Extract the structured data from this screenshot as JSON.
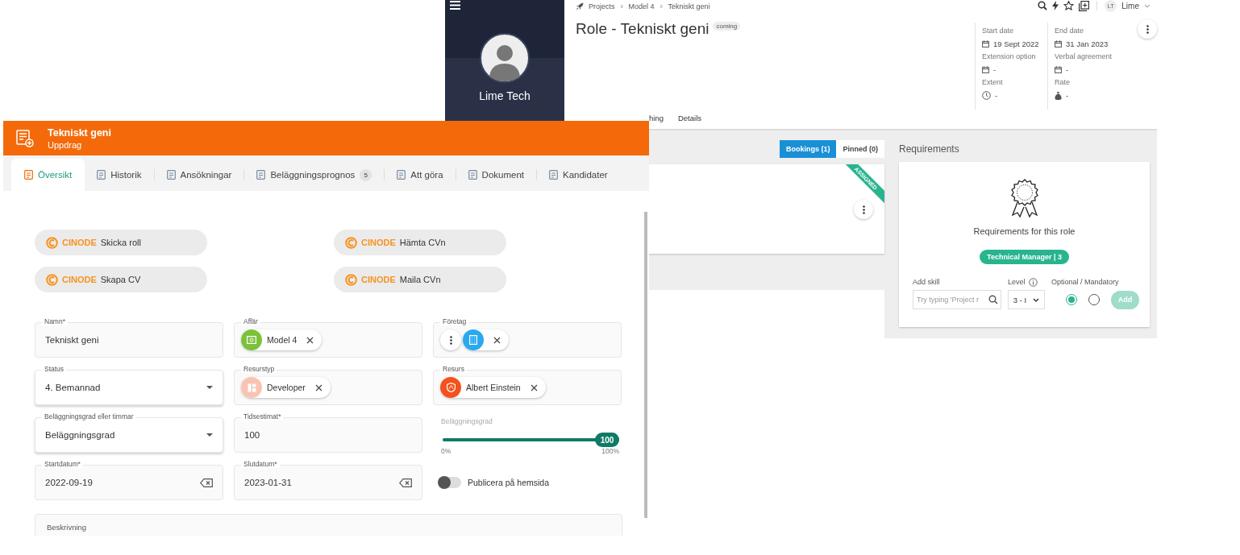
{
  "back_window": {
    "sidebar": {
      "user_name": "Lime Tech"
    },
    "breadcrumb": [
      "Projects",
      "Model 4",
      "Tekniskt geni"
    ],
    "title": "Role - Tekniskt geni",
    "status_badge": "coming",
    "user_menu": {
      "initials": "LT",
      "name": "Lime"
    },
    "info_columns": [
      [
        {
          "label": "Start date",
          "value": "19 Sept 2022",
          "kind": "date"
        },
        {
          "label": "Extension option",
          "value": "-",
          "kind": "date"
        },
        {
          "label": "Extent",
          "value": "-",
          "kind": "time"
        }
      ],
      [
        {
          "label": "End date",
          "value": "31 Jan 2023",
          "kind": "date"
        },
        {
          "label": "Verbal agreement",
          "value": "-",
          "kind": "date"
        },
        {
          "label": "Rate",
          "value": "-",
          "kind": "money"
        }
      ]
    ],
    "tabs": [
      {
        "label": "hing",
        "selected": false
      },
      {
        "label": "Details",
        "selected": false
      }
    ],
    "booking_filters": [
      {
        "label": "Bookings (1)",
        "selected": true
      },
      {
        "label": "Pinned (0)",
        "selected": false
      }
    ],
    "booking_card": {
      "ribbon": "ASSIGNED"
    },
    "requirements": {
      "title": "Requirements",
      "caption": "Requirements for this role",
      "skills": [
        "Technical Manager | 3"
      ],
      "add_skill_label": "Add skill",
      "placeholder": "Try typing 'Project r",
      "level_label": "Level",
      "level_value": "3 - I",
      "option_label": "Optional / Mandatory",
      "options": [
        {
          "selected": true
        },
        {
          "selected": false
        }
      ],
      "add_button": {
        "label": "Add",
        "disabled": true
      }
    }
  },
  "front_window": {
    "title": "Tekniskt geni",
    "subtitle": "Uppdrag",
    "tabs": [
      {
        "label": "Översikt",
        "selected": true
      },
      {
        "label": "Historik",
        "selected": false
      },
      {
        "label": "Ansökningar",
        "selected": false
      },
      {
        "label": "Beläggningsprognos",
        "selected": false,
        "badge": "5"
      },
      {
        "label": "Att göra",
        "selected": false
      },
      {
        "label": "Dokument",
        "selected": false
      },
      {
        "label": "Kandidater",
        "selected": false
      }
    ],
    "actions": [
      {
        "brand": "CINODE",
        "label": "Skicka roll"
      },
      {
        "brand": "CINODE",
        "label": "Hämta CVn"
      },
      {
        "brand": "CINODE",
        "label": "Skapa CV"
      },
      {
        "brand": "CINODE",
        "label": "Maila CVn"
      }
    ],
    "fields": [
      {
        "kind": "text",
        "label": "Namn*",
        "value": "Tekniskt geni"
      },
      {
        "kind": "chips",
        "label": "Affär",
        "chips": [
          {
            "kind": "deal",
            "text": "Model 4",
            "color": "#7cc13a"
          }
        ]
      },
      {
        "kind": "chips",
        "label": "Företag",
        "menu": true,
        "chips": [
          {
            "kind": "company",
            "color": "#2aa8f0"
          }
        ]
      },
      {
        "kind": "select",
        "label": "Status",
        "value": "4. Bemannad"
      },
      {
        "kind": "chips",
        "label": "Resurstyp",
        "chips": [
          {
            "kind": "resource-type",
            "text": "Developer",
            "color": "#f9c3b3"
          }
        ]
      },
      {
        "kind": "chips",
        "label": "Resurs",
        "chips": [
          {
            "kind": "person",
            "text": "Albert Einstein",
            "color": "#f4511e"
          }
        ]
      },
      {
        "kind": "select",
        "label": "Beläggningsgrad eller timmar",
        "value": "Beläggningsgrad"
      },
      {
        "kind": "text",
        "label": "Tidsestimat*",
        "value": "100"
      },
      {
        "kind": "slider",
        "label": "Beläggningsgrad",
        "level": 1,
        "value": "100",
        "min_label": "0%",
        "max_label": "100%"
      },
      {
        "kind": "date",
        "label": "Startdatum*",
        "value": "2022-09-19"
      },
      {
        "kind": "date",
        "label": "Slutdatum*",
        "value": "2023-01-31"
      },
      {
        "kind": "toggle",
        "label": "Publicera på hemsida",
        "on": false
      }
    ],
    "description": {
      "label": "Beskrivning"
    }
  }
}
